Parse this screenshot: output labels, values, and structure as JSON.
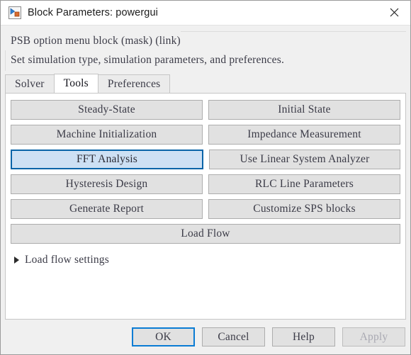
{
  "window": {
    "title": "Block Parameters: powergui",
    "icon": "simulink-block-icon",
    "close_icon": "close-icon"
  },
  "description": {
    "line1": "PSB option menu block (mask) (link)",
    "line2": "Set simulation type, simulation parameters, and preferences."
  },
  "tabs": [
    {
      "label": "Solver",
      "active": false
    },
    {
      "label": "Tools",
      "active": true
    },
    {
      "label": "Preferences",
      "active": false
    }
  ],
  "tools": {
    "rows": [
      [
        {
          "label": "Steady-State",
          "selected": false
        },
        {
          "label": "Initial State",
          "selected": false
        }
      ],
      [
        {
          "label": "Machine Initialization",
          "selected": false
        },
        {
          "label": "Impedance Measurement",
          "selected": false
        }
      ],
      [
        {
          "label": "FFT Analysis",
          "selected": true
        },
        {
          "label": "Use Linear System Analyzer",
          "selected": false
        }
      ],
      [
        {
          "label": "Hysteresis Design",
          "selected": false
        },
        {
          "label": "RLC Line Parameters",
          "selected": false
        }
      ],
      [
        {
          "label": "Generate Report",
          "selected": false
        },
        {
          "label": "Customize SPS blocks",
          "selected": false
        }
      ]
    ],
    "full_width_button": {
      "label": "Load Flow",
      "selected": false
    },
    "expander": {
      "label": "Load flow settings",
      "expanded": false,
      "icon": "triangle-right-icon"
    }
  },
  "footer": {
    "buttons": [
      {
        "label": "OK",
        "state": "focused"
      },
      {
        "label": "Cancel",
        "state": "normal"
      },
      {
        "label": "Help",
        "state": "normal"
      },
      {
        "label": "Apply",
        "state": "disabled"
      }
    ]
  },
  "colors": {
    "selection_fill": "#cde0f4",
    "selection_border": "#0a64a8",
    "focus_border": "#0a7cd4",
    "button_face": "#e1e1e1",
    "button_border": "#adadad",
    "window_bg": "#f0f0f0",
    "panel_bg": "#ffffff",
    "text": "#3b3b47",
    "disabled_text": "#a9a9b2"
  }
}
